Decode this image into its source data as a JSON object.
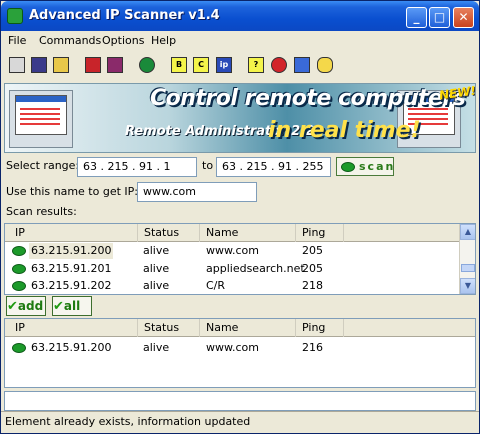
{
  "window": {
    "title": "Advanced IP Scanner v1.4"
  },
  "titlebar_buttons": {
    "minimize": "_",
    "maximize": "□",
    "close": "✕"
  },
  "menu": [
    "File",
    "Commands",
    "Options",
    "Help"
  ],
  "toolbar": {
    "icons": [
      "disk-icon",
      "save-icon",
      "folder-open-icon",
      "red-computer-icon",
      "computers-icon",
      "globe-icon",
      "b-note-icon",
      "c-note-icon",
      "ip-icon",
      "help-icon",
      "stop-icon",
      "network-icon",
      "db-icon"
    ],
    "labels": {
      "b": "B",
      "c": "C",
      "ip": "ip",
      "help": "?"
    }
  },
  "banner": {
    "headline": "Control remote computers",
    "product": "Remote Administrator 2.2",
    "tagline": "in real time!",
    "badge": "NEW!"
  },
  "range": {
    "label": "Select range:",
    "from": "63 . 215 . 91 . 1",
    "to_label": "to",
    "to": "63 . 215 . 91 . 255",
    "scan_button": "scan"
  },
  "name_lookup": {
    "label": "Use this name to get IP:",
    "value": "www.com"
  },
  "results_label": "Scan results:",
  "columns": [
    "IP",
    "Status",
    "Name",
    "Ping"
  ],
  "scan_results": [
    {
      "ip": "63.215.91.200",
      "status": "alive",
      "name": "www.com",
      "ping": "205"
    },
    {
      "ip": "63.215.91.201",
      "status": "alive",
      "name": "appliedsearch.net",
      "ping": "205"
    },
    {
      "ip": "63.215.91.202",
      "status": "alive",
      "name": "C/R",
      "ping": "218"
    }
  ],
  "buttons": {
    "add": "add",
    "all": "all",
    "check_glyph": "✔"
  },
  "saved_list": [
    {
      "ip": "63.215.91.200",
      "status": "alive",
      "name": "www.com",
      "ping": "216"
    }
  ],
  "scroll_arrows": {
    "up": "▲",
    "down": "▼"
  },
  "status_text": "Element already exists, information updated",
  "colors": {
    "titlebar": "#0a4fd0",
    "alive_indicator": "#1c9a2a",
    "scan_text": "#2a7a1a",
    "window_bg": "#ece9d8"
  }
}
